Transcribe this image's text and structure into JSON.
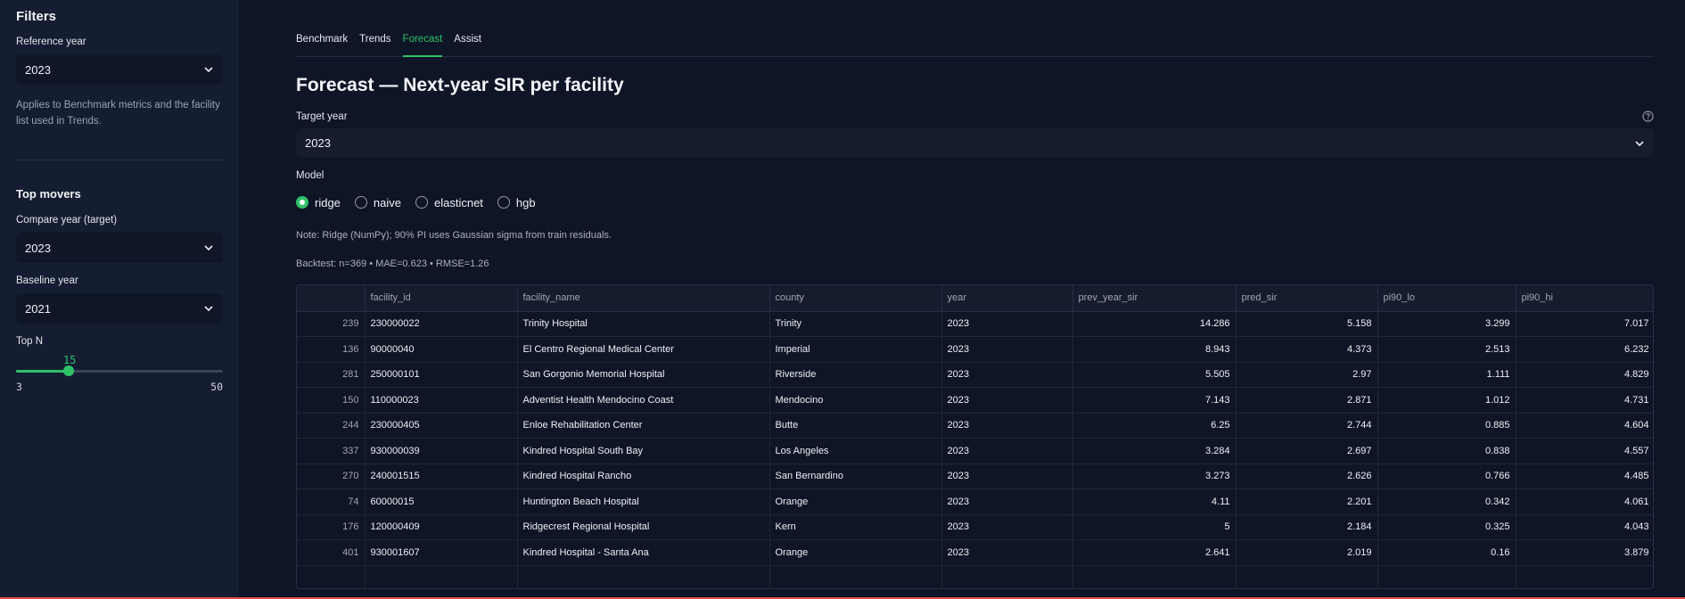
{
  "sidebar": {
    "title": "Filters",
    "reference_year_label": "Reference year",
    "reference_year_value": "2023",
    "reference_help": "Applies to Benchmark metrics and the facility list used in Trends.",
    "top_movers_title": "Top movers",
    "compare_year_label": "Compare year (target)",
    "compare_year_value": "2023",
    "baseline_year_label": "Baseline year",
    "baseline_year_value": "2021",
    "topn_label": "Top N",
    "topn_value": "15",
    "topn_min": "3",
    "topn_max": "50",
    "topn_fraction": 0.255
  },
  "tabs": [
    "Benchmark",
    "Trends",
    "Forecast",
    "Assist"
  ],
  "active_tab": "Forecast",
  "main": {
    "title": "Forecast — Next-year SIR per facility",
    "target_year_label": "Target year",
    "target_year_value": "2023",
    "model_label": "Model",
    "models": [
      "ridge",
      "naive",
      "elasticnet",
      "hgb"
    ],
    "selected_model": "ridge",
    "note": "Note: Ridge (NumPy); 90% PI uses Gaussian sigma from train residuals.",
    "backtest": "Backtest: n=369 • MAE=0.623 • RMSE=1.26"
  },
  "table": {
    "columns": [
      "",
      "facility_id",
      "facility_name",
      "county",
      "year",
      "prev_year_sir",
      "pred_sir",
      "pi90_lo",
      "pi90_hi"
    ],
    "rows": [
      [
        "239",
        "230000022",
        "Trinity Hospital",
        "Trinity",
        "2023",
        "14.286",
        "5.158",
        "3.299",
        "7.017"
      ],
      [
        "136",
        "90000040",
        "El Centro Regional Medical Center",
        "Imperial",
        "2023",
        "8.943",
        "4.373",
        "2.513",
        "6.232"
      ],
      [
        "281",
        "250000101",
        "San Gorgonio Memorial Hospital",
        "Riverside",
        "2023",
        "5.505",
        "2.97",
        "1.111",
        "4.829"
      ],
      [
        "150",
        "110000023",
        "Adventist Health Mendocino Coast",
        "Mendocino",
        "2023",
        "7.143",
        "2.871",
        "1.012",
        "4.731"
      ],
      [
        "244",
        "230000405",
        "Enloe Rehabilitation Center",
        "Butte",
        "2023",
        "6.25",
        "2.744",
        "0.885",
        "4.604"
      ],
      [
        "337",
        "930000039",
        "Kindred Hospital South Bay",
        "Los Angeles",
        "2023",
        "3.284",
        "2.697",
        "0.838",
        "4.557"
      ],
      [
        "270",
        "240001515",
        "Kindred Hospital Rancho",
        "San Bernardino",
        "2023",
        "3.273",
        "2.626",
        "0.766",
        "4.485"
      ],
      [
        "74",
        "60000015",
        "Huntington Beach Hospital",
        "Orange",
        "2023",
        "4.11",
        "2.201",
        "0.342",
        "4.061"
      ],
      [
        "176",
        "120000409",
        "Ridgecrest Regional Hospital",
        "Kern",
        "2023",
        "5",
        "2.184",
        "0.325",
        "4.043"
      ],
      [
        "401",
        "930001607",
        "Kindred Hospital - Santa Ana",
        "Orange",
        "2023",
        "2.641",
        "2.019",
        "0.16",
        "3.879"
      ],
      [
        "",
        "",
        "",
        "",
        "",
        "",
        "",
        "",
        ""
      ]
    ]
  },
  "colors": {
    "accent": "#2fc26b",
    "background": "#0e1526",
    "sidebar": "#141d31"
  }
}
